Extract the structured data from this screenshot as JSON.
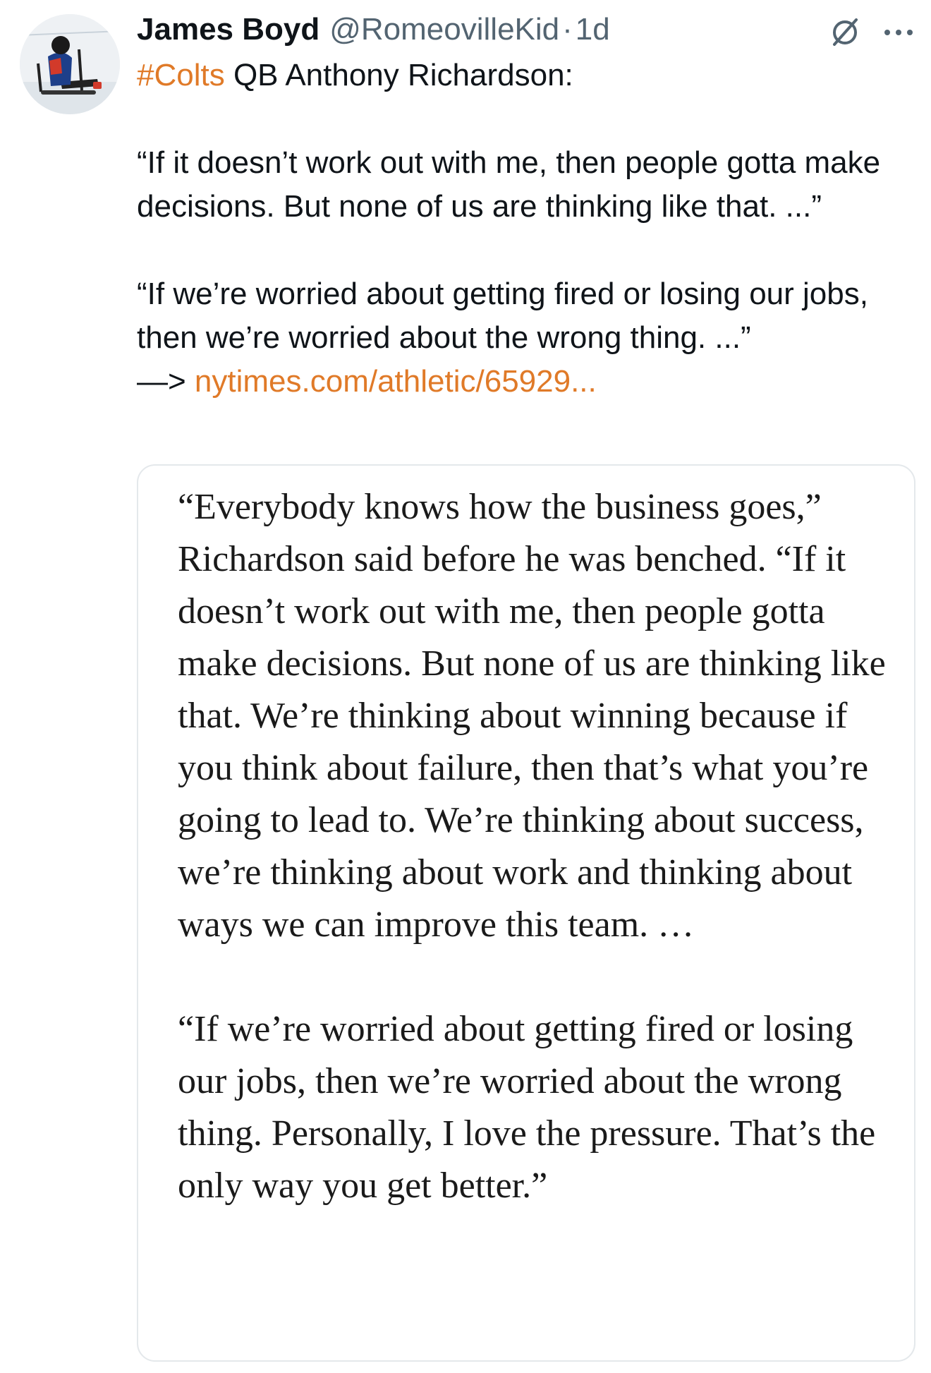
{
  "author": {
    "display_name": "James Boyd",
    "handle": "@RomeovilleKid",
    "separator": "·",
    "timestamp": "1d"
  },
  "icons": {
    "grok": "grok-icon",
    "more": "more-icon"
  },
  "tweet": {
    "hashtag": "#Colts",
    "line1_rest": " QB Anthony Richardson:",
    "para1": "“If it doesn’t work out with me, then people gotta make decisions. But none of us are thinking like that. ...”",
    "para2": "“If we’re worried about getting fired or losing our jobs, then we’re worried about the wrong thing. ...”",
    "arrow": "—> ",
    "link_text": "nytimes.com/athletic/65929..."
  },
  "quote_card": {
    "paragraph1": "“Everybody knows how the business goes,” Richardson said before he was benched. “If it doesn’t work out with me, then people gotta make decisions. But none of us are thinking like that. We’re thinking about winning because if you think about failure, then that’s what you’re going to lead to. We’re thinking about success, we’re thinking about work and thinking about ways we can improve this team. …",
    "paragraph2": "“If we’re worried about getting fired or losing our jobs, then we’re worried about the wrong thing. Personally, I love the pressure. That’s the only way you get better.”"
  },
  "colors": {
    "accent_link": "#e07a28",
    "secondary_text": "#536471",
    "card_border": "#e4e8eb"
  }
}
